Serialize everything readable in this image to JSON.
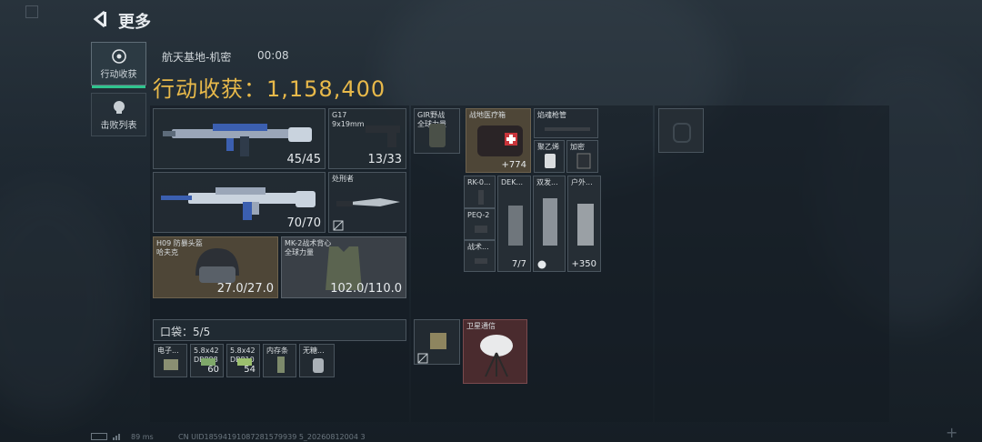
{
  "header": {
    "title": "更多"
  },
  "tabs": [
    {
      "label": "行动收获",
      "active": true
    },
    {
      "label": "击败列表",
      "active": false
    }
  ],
  "raid": {
    "map": "航天基地-机密",
    "time": "00:08",
    "haul_label": "行动收获：1,158,400"
  },
  "gear": {
    "primary1": {
      "value": "45/45"
    },
    "sidearm": {
      "name": "G17",
      "ammo": "9x19mm",
      "value": "13/33"
    },
    "primary2": {
      "value": "70/70"
    },
    "melee": {
      "name": "处刑者"
    },
    "helmet": {
      "name": "H09 防暴头盔",
      "sub": "哈夫克",
      "value": "27.0/27.0"
    },
    "armor": {
      "name": "MK-2战术背心",
      "sub": "全球力量",
      "value": "102.0/110.0"
    }
  },
  "pockets": {
    "label": "口袋：5/5",
    "items": [
      {
        "name": "电子...",
        "count": ""
      },
      {
        "name": "5.8x42",
        "sub": "DBP88",
        "count": "60"
      },
      {
        "name": "5.8x42",
        "sub": "DBP10",
        "count": "54"
      },
      {
        "name": "内存条",
        "count": ""
      },
      {
        "name": "无糖...",
        "count": ""
      }
    ]
  },
  "chest_rig": {
    "name": "GIR野战",
    "sub": "全球力量"
  },
  "backpack_items": {
    "medkit": {
      "name": "战地医疗箱",
      "count": "+774"
    },
    "fuse": {
      "name": "焰魂枪管"
    },
    "jar": {
      "name": "聚乙烯"
    },
    "tablet": {
      "name": "加密"
    },
    "rk": {
      "name": "RK-0..."
    },
    "peq": {
      "name": "PEQ-2"
    },
    "tac": {
      "name": "战术..."
    },
    "dek": {
      "name": "DEK...",
      "count": "7/7"
    },
    "dual": {
      "name": "双发..."
    },
    "outdoor": {
      "name": "户外...",
      "count": "+350"
    },
    "satellite": {
      "name": "卫星通信"
    }
  },
  "footer": {
    "ping": "89 ms",
    "uid": "CN UID18594191087281579939 5_20260812004 3"
  },
  "colors": {
    "haul": "#e8b94a",
    "accent_green": "#2fc48e"
  }
}
